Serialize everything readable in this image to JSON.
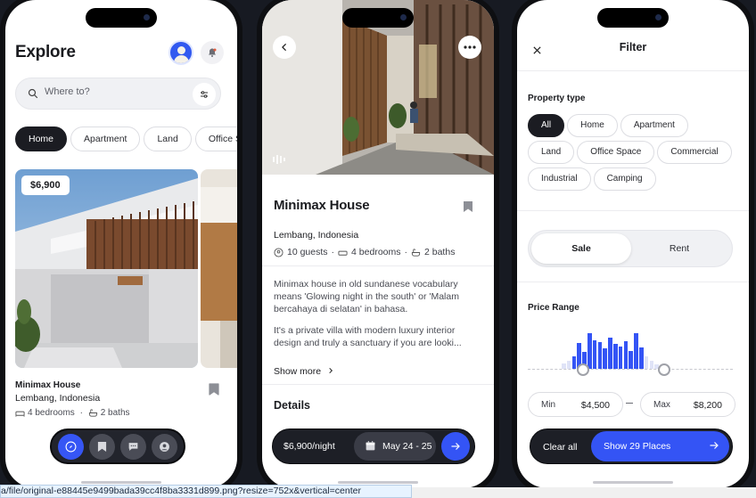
{
  "explore": {
    "title": "Explore",
    "search_placeholder": "Where to?",
    "categories": [
      "Home",
      "Apartment",
      "Land",
      "Office S"
    ],
    "card": {
      "price": "$6,900",
      "name": "Minimax House",
      "location": "Lembang, Indonesia",
      "bedrooms": "4 bedrooms",
      "baths": "2 baths"
    },
    "nav": [
      "compass-icon",
      "bookmark-icon",
      "chat-icon",
      "profile-icon"
    ],
    "accent": "#3656f5"
  },
  "detail": {
    "title": "Minimax House",
    "location": "Lembang, Indonesia",
    "guests": "10 guests",
    "bedrooms": "4 bedrooms",
    "baths": "2 baths",
    "description_1": "Minimax house in old sundanese vocabulary means 'Glowing night in the south' or 'Malam bercahaya di selatan' in bahasa.",
    "description_2": "It's a private villa with modern luxury interior design and truly a sanctuary if you are looki...",
    "show_more": "Show more",
    "details_heading": "Details",
    "price_per_night": "$6,900/night",
    "dates": "May 24 - 25"
  },
  "filter": {
    "title": "Filter",
    "property_type_heading": "Property type",
    "property_types": [
      {
        "label": "All",
        "active": true
      },
      {
        "label": "Home",
        "active": false
      },
      {
        "label": "Apartment",
        "active": false
      },
      {
        "label": "Land",
        "active": false
      },
      {
        "label": "Office Space",
        "active": false
      },
      {
        "label": "Commercial",
        "active": false
      },
      {
        "label": "Industrial",
        "active": false
      },
      {
        "label": "Camping",
        "active": false
      }
    ],
    "sale_label": "Sale",
    "rent_label": "Rent",
    "price_range_heading": "Price Range",
    "min_label": "Min",
    "min_value": "$4,500",
    "max_label": "Max",
    "max_value": "$8,200",
    "histogram": [
      0.12,
      0.2,
      0.3,
      0.62,
      0.42,
      0.86,
      0.7,
      0.66,
      0.5,
      0.76,
      0.6,
      0.55,
      0.68,
      0.44,
      0.86,
      0.52,
      0.3,
      0.2,
      0.1
    ],
    "histogram_selected_from": 2,
    "histogram_selected_to": 15,
    "clear_all": "Clear all",
    "show_places": "Show 29 Places",
    "accent": "#3454f5"
  },
  "browser": {
    "status_url": "a/file/original-e88445e9499bada39cc4f8ba3331d899.png?resize=752x&vertical=center"
  }
}
